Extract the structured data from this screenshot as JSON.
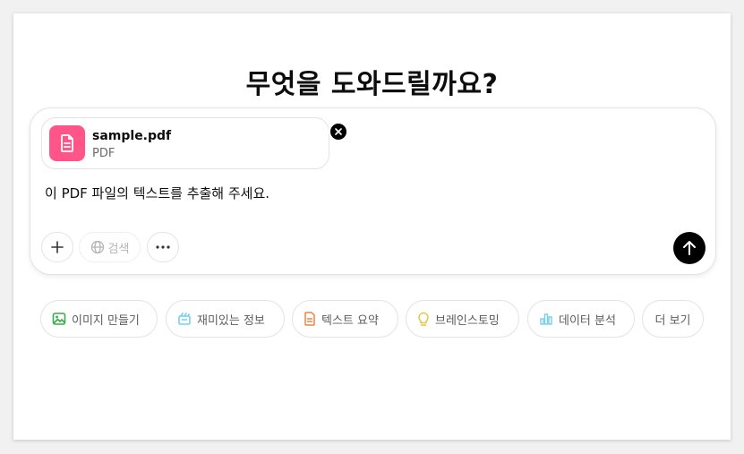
{
  "heading": "무엇을 도와드릴까요?",
  "attachment": {
    "name": "sample.pdf",
    "type": "PDF",
    "icon": "document-icon",
    "icon_bg": "#ff5588"
  },
  "prompt": "이 PDF 파일의 텍스트를 추출해 주세요.",
  "toolbar": {
    "search_label": "검색"
  },
  "suggestions": [
    {
      "label": "이미지 만들기",
      "icon": "image-icon",
      "color": "#35ae47"
    },
    {
      "label": "재미있는 정보",
      "icon": "graduation-cap-icon",
      "color": "#76d0eb"
    },
    {
      "label": "텍스트 요약",
      "icon": "document-icon",
      "color": "#ea8444"
    },
    {
      "label": "브레인스토밍",
      "icon": "lightbulb-icon",
      "color": "#e2c541"
    },
    {
      "label": "데이터 분석",
      "icon": "bar-chart-icon",
      "color": "#76d0eb"
    },
    {
      "label": "더 보기",
      "icon": "",
      "color": ""
    }
  ]
}
